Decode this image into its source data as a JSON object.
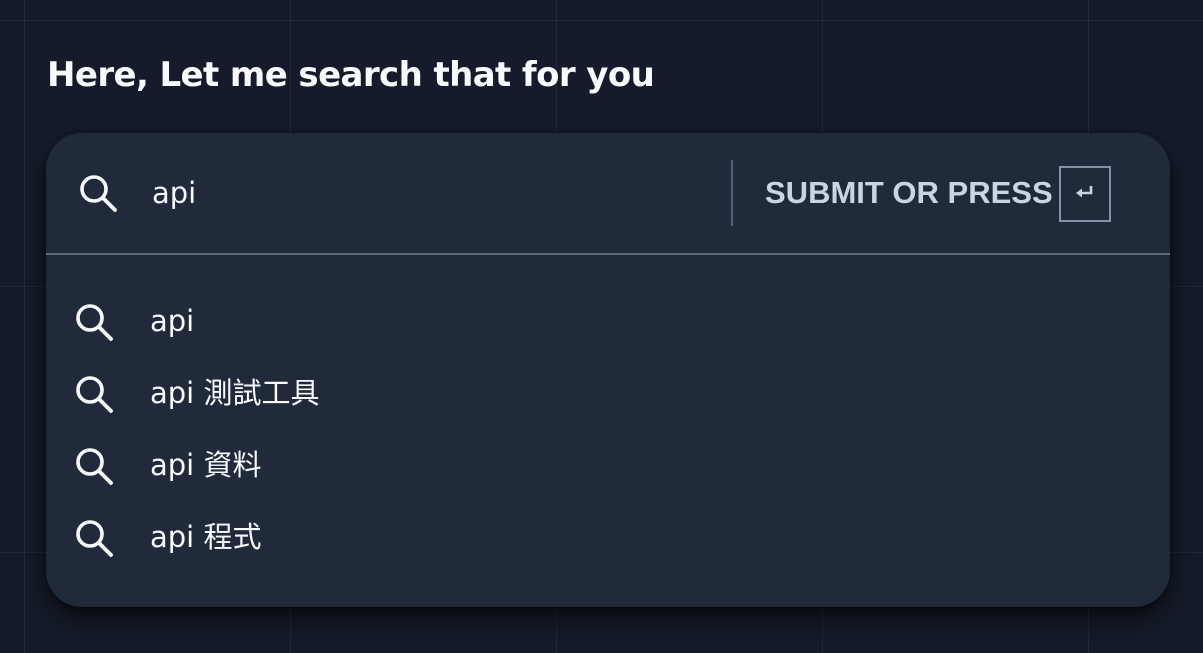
{
  "page": {
    "title": "Here, Let me search that for you"
  },
  "search": {
    "query": "api",
    "icon": "search-icon",
    "submit_label": "SUBMIT OR PRESS",
    "enter_key_icon": "enter-key-icon"
  },
  "suggestions": [
    {
      "text": "api",
      "icon": "search-icon"
    },
    {
      "text": "api 測試工具",
      "icon": "search-icon"
    },
    {
      "text": "api 資料",
      "icon": "search-icon"
    },
    {
      "text": "api 程式",
      "icon": "search-icon"
    }
  ],
  "colors": {
    "background": "#151b2a",
    "panel": "#202a3b",
    "text": "#f8fafc",
    "muted": "#cbd5e1",
    "border": "#5d6878"
  }
}
